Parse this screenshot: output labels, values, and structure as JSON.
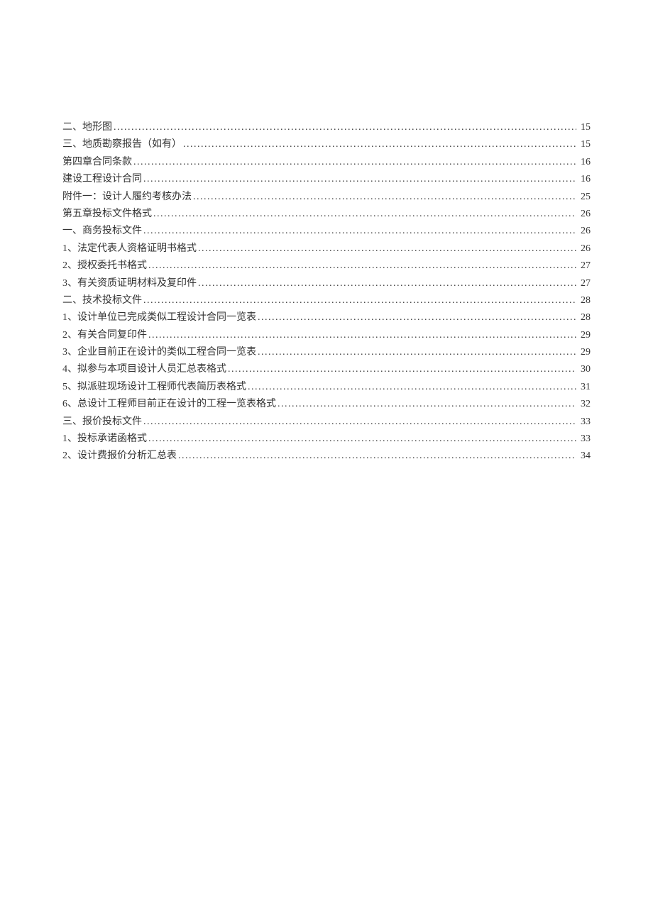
{
  "toc": {
    "entries": [
      {
        "label": "二、地形图",
        "page": "15"
      },
      {
        "label": "三、地质勘察报告（如有）",
        "page": "15"
      },
      {
        "label": "第四章合同条款",
        "page": "16"
      },
      {
        "label": "建设工程设计合同",
        "page": "16"
      },
      {
        "label": "附件一：设计人履约考核办法",
        "page": "25"
      },
      {
        "label": "第五章投标文件格式",
        "page": "26"
      },
      {
        "label": "一、商务投标文件",
        "page": "26"
      },
      {
        "label": "1、法定代表人资格证明书格式",
        "page": "26"
      },
      {
        "label": "2、授权委托书格式",
        "page": "27"
      },
      {
        "label": "3、有关资质证明材料及复印件",
        "page": "27"
      },
      {
        "label": "二、技术投标文件",
        "page": "28"
      },
      {
        "label": "1、设计单位已完成类似工程设计合同一览表",
        "page": "28"
      },
      {
        "label": "2、有关合同复印件",
        "page": "29"
      },
      {
        "label": "3、企业目前正在设计的类似工程合同一览表",
        "page": "29"
      },
      {
        "label": "4、拟参与本项目设计人员汇总表格式",
        "page": "30"
      },
      {
        "label": "5、拟派驻现场设计工程师代表简历表格式",
        "page": "31"
      },
      {
        "label": "6、总设计工程师目前正在设计的工程一览表格式",
        "page": "32"
      },
      {
        "label": "三、报价投标文件",
        "page": "33"
      },
      {
        "label": "1、投标承诺函格式",
        "page": "33"
      },
      {
        "label": "2、设计费报价分析汇总表",
        "page": "34"
      }
    ]
  }
}
